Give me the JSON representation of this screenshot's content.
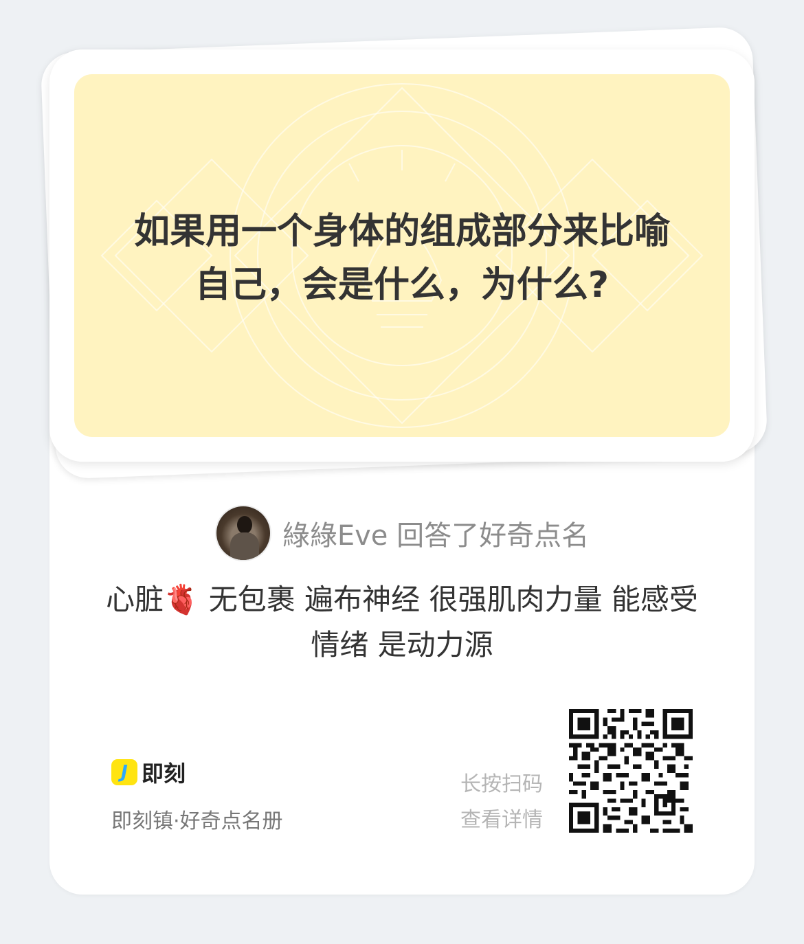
{
  "question": {
    "line1": "如果用一个身体的组成部分来比喻",
    "line2": "自己，会是什么，为什么?"
  },
  "author": {
    "name": "綠綠Eve",
    "action": "回答了好奇点名"
  },
  "answer": {
    "part_before_emoji": "心脏",
    "emoji": "🫀",
    "part_after_emoji": "无包裹 遍布神经 很强肌肉力量 能感受情绪 是动力源"
  },
  "footer": {
    "brand_icon_letter": "J",
    "brand_name": "即刻",
    "brand_sub": "即刻镇·好奇点名册",
    "scan_hint_line1": "长按扫码",
    "scan_hint_line2": "查看详情"
  },
  "colors": {
    "page_bg": "#eef1f4",
    "card_bg": "#ffffff",
    "question_bg": "#fff3c0",
    "brand_yellow": "#ffe411",
    "brand_blue": "#2ba9ff"
  },
  "icons": {
    "heart": "anatomical-heart-emoji",
    "qr": "qr-code-icon",
    "brand": "jike-logo-icon"
  }
}
